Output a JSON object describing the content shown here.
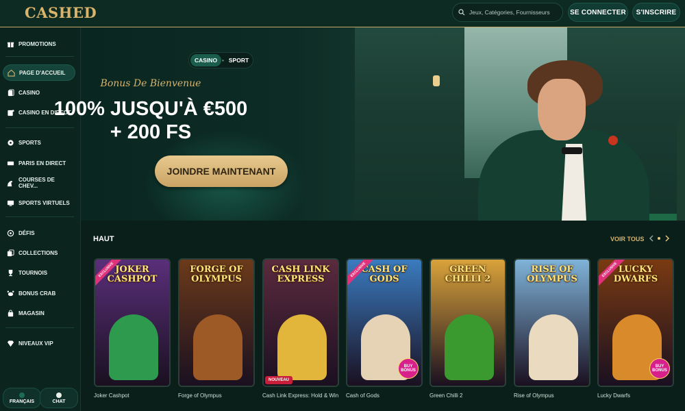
{
  "header": {
    "logo": "CASHED",
    "search_placeholder": "Jeux, Catégories, Fournisseurs",
    "login_label": "SE CONNECTER",
    "signup_label": "S'INSCRIRE"
  },
  "sidebar": {
    "items": [
      {
        "label": "PROMOTIONS",
        "icon": "gift-icon"
      },
      {
        "label": "PAGE D'ACCUEIL",
        "icon": "home-icon"
      },
      {
        "label": "CASINO",
        "icon": "cards-icon"
      },
      {
        "label": "CASINO EN DIRECT",
        "icon": "live-cards-icon"
      },
      {
        "label": "SPORTS",
        "icon": "soccer-ball-icon"
      },
      {
        "label": "PARIS EN DIRECT",
        "icon": "live-badge-icon"
      },
      {
        "label": "COURSES DE CHEV...",
        "icon": "horse-icon"
      },
      {
        "label": "SPORTS VIRTUELS",
        "icon": "virtual-sports-icon"
      },
      {
        "label": "DÉFIS",
        "icon": "target-icon"
      },
      {
        "label": "COLLECTIONS",
        "icon": "collection-icon"
      },
      {
        "label": "TOURNOIS",
        "icon": "trophy-icon"
      },
      {
        "label": "BONUS CRAB",
        "icon": "crab-icon"
      },
      {
        "label": "MAGASIN",
        "icon": "shopping-bag-icon"
      },
      {
        "label": "NIVEAUX VIP",
        "icon": "diamond-icon"
      }
    ],
    "language_label": "FRANÇAIS",
    "chat_label": "CHAT"
  },
  "hero": {
    "tabs": [
      "CASINO",
      "SPORT"
    ],
    "active_tab": "CASINO",
    "bonus_label": "Bonus De Bienvenue",
    "headline_line1": "100% JUSQU'À €500",
    "headline_line2": "+ 200 FS",
    "cta_label": "JOINDRE MAINTENANT"
  },
  "games_section": {
    "title": "HAUT",
    "see_all_label": "VOIR TOUS",
    "games": [
      {
        "name": "Joker Cashpot",
        "art_title": "JOKER CASHPOT",
        "badge": "EXCLUSIVE",
        "bg": "#5a2f7a",
        "accent": "#2e9a4d"
      },
      {
        "name": "Forge of Olympus",
        "art_title": "FORGE OF OLYMPUS",
        "bg": "#6b3a1a",
        "accent": "#9e5a26"
      },
      {
        "name": "Cash Link Express: Hold & Win",
        "art_title": "CASH LINK EXPRESS",
        "new_badge": "NOUVEAU",
        "bg": "#5b2a3e",
        "accent": "#e2b63a"
      },
      {
        "name": "Cash of Gods",
        "art_title": "CASH OF GODS",
        "badge": "EXCLUSIVE",
        "buy_label": "BUY BONUS",
        "bg": "#3a7bbf",
        "accent": "#e6d3b6"
      },
      {
        "name": "Green Chilli 2",
        "art_title": "GREEN CHILLI 2",
        "bg": "#d9a23a",
        "accent": "#3b9a2f"
      },
      {
        "name": "Rise of Olympus",
        "art_title": "RISE OF OLYMPUS",
        "bg": "#7fb3d9",
        "accent": "#e9dac0"
      },
      {
        "name": "Lucky Dwarfs",
        "art_title": "LUCKY DWARFS",
        "badge": "EXCLUSIVE",
        "buy_label": "BUY BONUS",
        "bg": "#7a3a12",
        "accent": "#d98a2a"
      }
    ]
  }
}
